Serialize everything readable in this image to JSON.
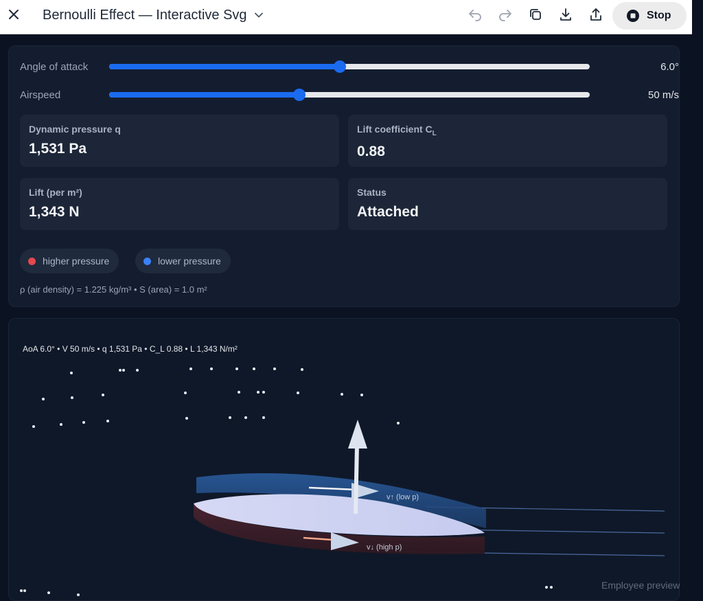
{
  "header": {
    "title": "Bernoulli Effect — Interactive Svg",
    "stop_label": "Stop",
    "icons": [
      "close-icon",
      "chevron-down-icon",
      "undo-icon",
      "redo-icon",
      "copy-icon",
      "download-icon",
      "share-icon",
      "stop-icon"
    ]
  },
  "controls": {
    "angle": {
      "label": "Angle of attack",
      "value": "6.0°",
      "fraction": 0.48
    },
    "airspeed": {
      "label": "Airspeed",
      "value": "50 m/s",
      "fraction": 0.395
    }
  },
  "metrics": {
    "dynamic_pressure": {
      "label": "Dynamic pressure q",
      "value": "1,531 Pa"
    },
    "lift_coefficient": {
      "label": "Lift coefficient C",
      "label_sub": "L",
      "value": "0.88"
    },
    "lift": {
      "label": "Lift (per m²)",
      "value": "1,343 N"
    },
    "status": {
      "label": "Status",
      "value": "Attached"
    }
  },
  "legend": {
    "higher": {
      "label": "higher pressure",
      "color": "#e5484d"
    },
    "lower": {
      "label": "lower pressure",
      "color": "#3b82f6"
    }
  },
  "note": "ρ (air density) = 1.225 kg/m³ • S (area) = 1.0 m²",
  "visual": {
    "readout": "AoA 6.0° • V 50 m/s • q 1,531 Pa • C_L 0.88 • L 1,343 N/m²",
    "upper_label": "v↑ (low p)",
    "lower_label": "v↓ (high p)"
  },
  "footer": {
    "preview_label": "Employee preview"
  }
}
